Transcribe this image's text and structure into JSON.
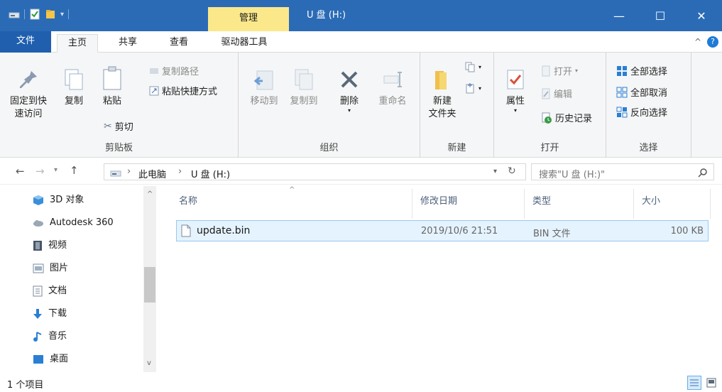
{
  "window": {
    "context_tab": "管理",
    "title": "U 盘 (H:)",
    "controls": {
      "minimize": "—",
      "maximize": "☐",
      "close": "✕"
    }
  },
  "ribbon_tabs": {
    "file": "文件",
    "home": "主页",
    "share": "共享",
    "view": "查看",
    "drive_tools": "驱动器工具",
    "collapse": "^",
    "help": "?"
  },
  "ribbon": {
    "clipboard": {
      "pin_line1": "固定到快",
      "pin_line2": "速访问",
      "copy": "复制",
      "paste": "粘贴",
      "copy_path": "复制路径",
      "paste_shortcut": "粘贴快捷方式",
      "cut": "剪切",
      "label": "剪贴板"
    },
    "organize": {
      "move_to": "移动到",
      "copy_to": "复制到",
      "delete": "删除",
      "rename": "重命名",
      "label": "组织"
    },
    "new": {
      "new_folder_line1": "新建",
      "new_folder_line2": "文件夹",
      "label": "新建"
    },
    "open": {
      "properties": "属性",
      "open": "打开",
      "edit": "编辑",
      "history": "历史记录",
      "label": "打开"
    },
    "select": {
      "select_all": "全部选择",
      "select_none": "全部取消",
      "invert": "反向选择",
      "label": "选择"
    }
  },
  "address": {
    "sep": "›",
    "this_pc": "此电脑",
    "drive": "U 盘 (H:)",
    "search_placeholder": "搜索\"U 盘 (H:)\""
  },
  "nav_items": [
    "3D 对象",
    "Autodesk 360",
    "视频",
    "图片",
    "文档",
    "下载",
    "音乐",
    "桌面"
  ],
  "columns": {
    "name": "名称",
    "modified": "修改日期",
    "type": "类型",
    "size": "大小"
  },
  "files": [
    {
      "name": "update.bin",
      "modified": "2019/10/6 21:51",
      "type": "BIN 文件",
      "size": "100 KB"
    }
  ],
  "status": {
    "count": "1 个项目"
  },
  "colors": {
    "titlebar": "#2b6bb6",
    "file_tab": "#1f5fae",
    "manage_tab": "#fbe88a",
    "selection": "#e5f3ff"
  }
}
